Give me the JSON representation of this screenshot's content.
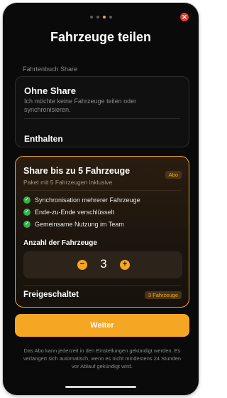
{
  "colors": {
    "accent": "#f5a623",
    "close": "#e23b2e",
    "check": "#2fb34a",
    "background": "#0a0a0a"
  },
  "pager": {
    "count": 4,
    "active_index": 2
  },
  "header": {
    "title": "Fahrzeuge teilen",
    "close_icon": "close-icon"
  },
  "section": {
    "label": "Fahrtenbuch Share"
  },
  "no_share": {
    "title": "Ohne Share",
    "description": "Ich möchte keine Fahrzeuge teilen oder synchronisieren.",
    "included_label": "Enthalten"
  },
  "abo": {
    "title": "Share bis zu 5 Fahrzeuge",
    "subtitle": "Paket mit 5 Fahrzeugen inklusive",
    "badge": "Abo",
    "features": [
      "Synchronisation mehrerer Fahrzeuge",
      "Ende-zu-Ende verschlüsselt",
      "Gemeinsame Nutzung im Team"
    ],
    "count_label": "Anzahl der Fahrzeuge",
    "count_value": "3",
    "minus_symbol": "−",
    "plus_symbol": "+",
    "unlocked_label": "Freigeschaltet",
    "unlocked_badge": "3 Fahrzeuge"
  },
  "cta": {
    "label": "Weiter"
  },
  "disclaimer": "Das Abo kann jederzeit in den Einstellungen gekündigt werden. Es verlängert sich automatisch, wenn es nicht mindestens 24 Stunden vor Ablauf gekündigt wird."
}
